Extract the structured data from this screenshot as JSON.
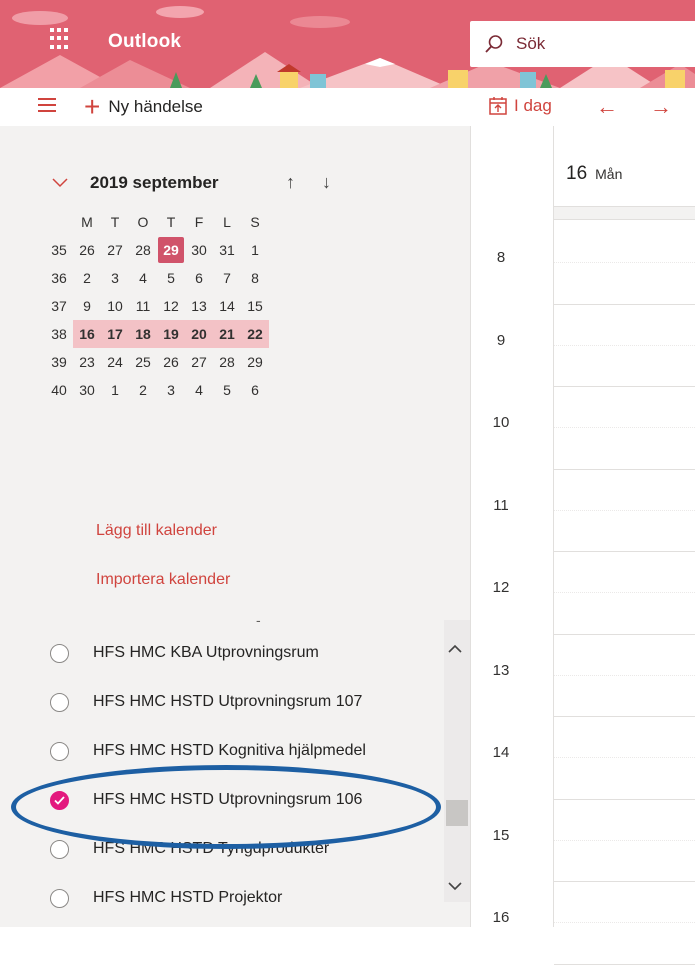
{
  "app": {
    "name": "Outlook"
  },
  "search": {
    "label": "Sök"
  },
  "toolbar": {
    "new_event": "Ny händelse",
    "today": "I dag"
  },
  "mini_calendar": {
    "title": "2019 september",
    "weekday_headers": [
      "M",
      "T",
      "O",
      "T",
      "F",
      "L",
      "S"
    ],
    "weeks": [
      {
        "week": "35",
        "days": [
          "26",
          "27",
          "28",
          "29",
          "30",
          "31",
          "1"
        ]
      },
      {
        "week": "36",
        "days": [
          "2",
          "3",
          "4",
          "5",
          "6",
          "7",
          "8"
        ]
      },
      {
        "week": "37",
        "days": [
          "9",
          "10",
          "11",
          "12",
          "13",
          "14",
          "15"
        ]
      },
      {
        "week": "38",
        "days": [
          "16",
          "17",
          "18",
          "19",
          "20",
          "21",
          "22"
        ]
      },
      {
        "week": "39",
        "days": [
          "23",
          "24",
          "25",
          "26",
          "27",
          "28",
          "29"
        ]
      },
      {
        "week": "40",
        "days": [
          "30",
          "1",
          "2",
          "3",
          "4",
          "5",
          "6"
        ]
      }
    ],
    "today_marker": "29",
    "selected_week": "38"
  },
  "links": {
    "add_calendar": "Lägg till kalender",
    "import_calendar": "Importera kalender",
    "dash": "-"
  },
  "calendars": [
    {
      "label": "HFS HMC KBA Utprovningsrum",
      "checked": false
    },
    {
      "label": "HFS HMC HSTD Utprovningsrum 107",
      "checked": false
    },
    {
      "label": "HFS HMC HSTD Kognitiva hjälpmedel",
      "checked": false
    },
    {
      "label": "HFS HMC HSTD Utprovningsrum 106",
      "checked": true
    },
    {
      "label": "HFS HMC HSTD Tyngdprodukter",
      "checked": false
    },
    {
      "label": "HFS HMC HSTD Projektor",
      "checked": false
    }
  ],
  "day_view": {
    "day_number": "16",
    "day_name": "Mån",
    "hours": [
      "8",
      "9",
      "10",
      "11",
      "12",
      "13",
      "14",
      "15",
      "16"
    ]
  },
  "colors": {
    "header": "#e06272",
    "accent": "#d0443e",
    "selected_week": "#f3c2c6",
    "checked": "#e3197e",
    "ring": "#1d5fa3"
  },
  "icons": [
    "waffle-icon",
    "search-icon",
    "hamburger-icon",
    "plus-icon",
    "calendar-today-icon",
    "arrow-left-icon",
    "arrow-right-icon",
    "chevron-down-icon",
    "arrow-up-icon",
    "arrow-down-icon",
    "check-icon"
  ]
}
